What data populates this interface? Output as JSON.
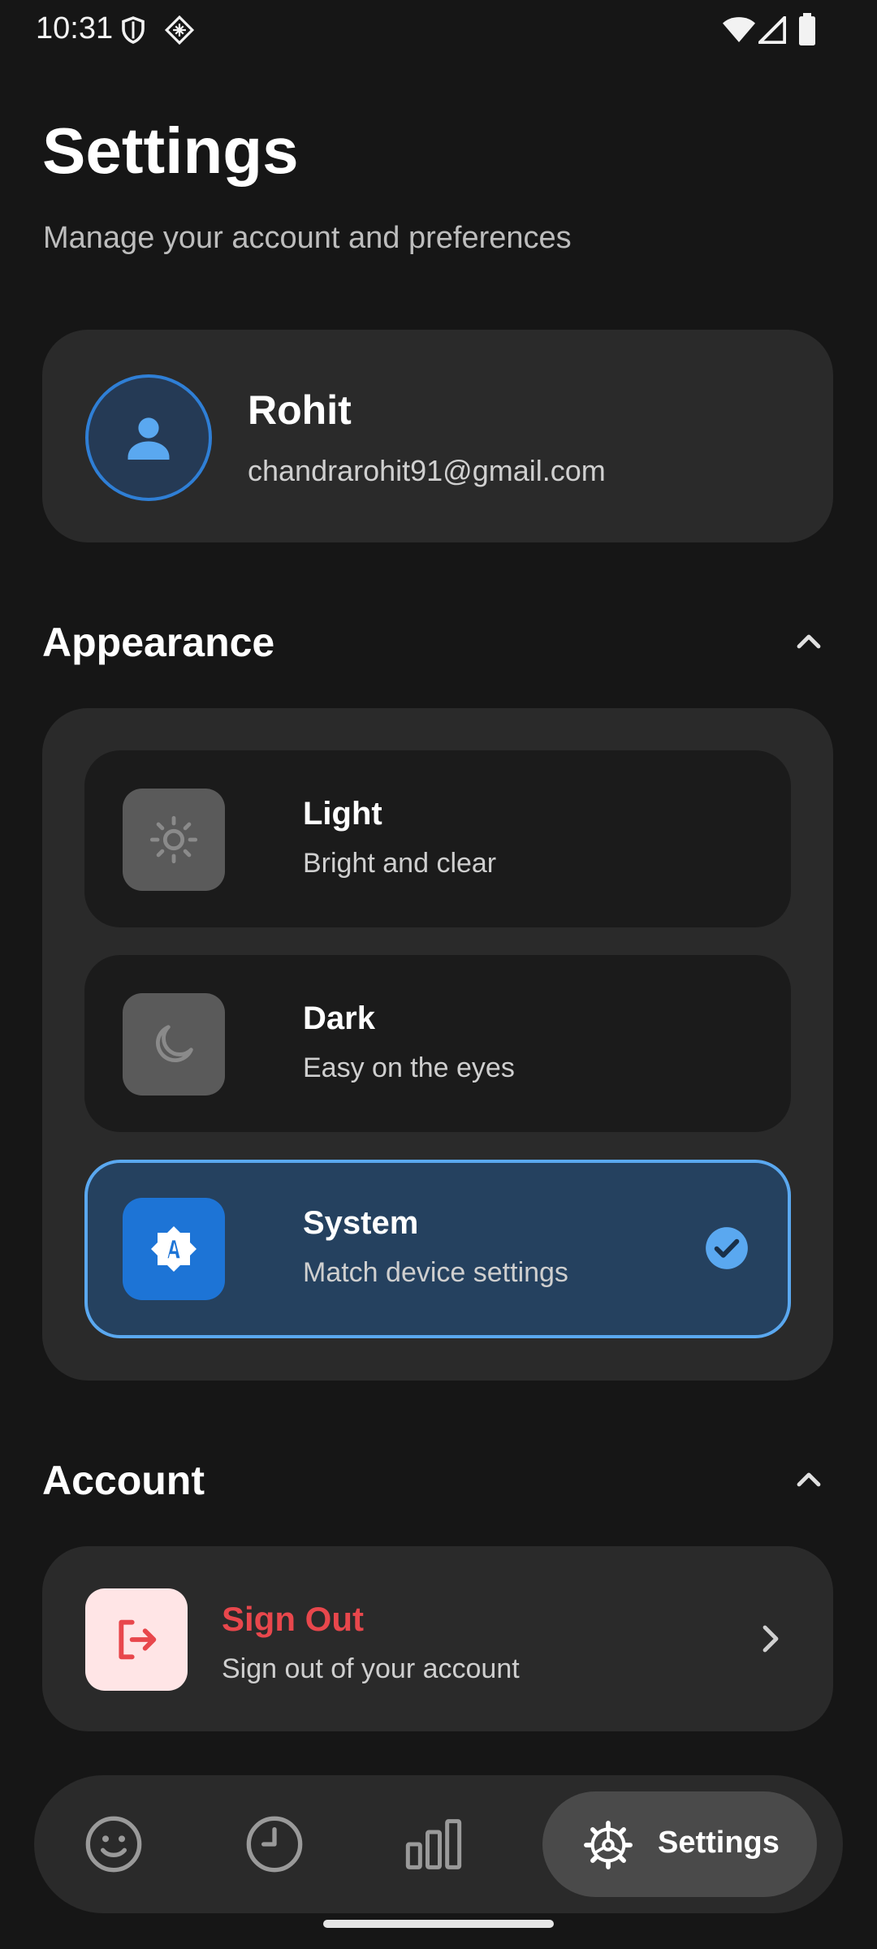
{
  "status_bar": {
    "time": "10:31",
    "left_icons": [
      "shield-icon",
      "diamond-grid-icon"
    ],
    "right_icons": [
      "wifi-icon",
      "cellular-icon",
      "battery-icon"
    ]
  },
  "header": {
    "title": "Settings",
    "subtitle": "Manage your account and preferences"
  },
  "profile": {
    "name": "Rohit",
    "email": "chandrarohit91@gmail.com",
    "avatar_icon": "person-icon"
  },
  "appearance": {
    "section_title": "Appearance",
    "collapse_icon": "chevron-up-icon",
    "options": [
      {
        "title": "Light",
        "description": "Bright and clear",
        "icon": "sun-icon",
        "selected": false
      },
      {
        "title": "Dark",
        "description": "Easy on the eyes",
        "icon": "moon-icon",
        "selected": false
      },
      {
        "title": "System",
        "description": "Match device settings",
        "icon": "auto-brightness-icon",
        "selected": true
      }
    ]
  },
  "account": {
    "section_title": "Account",
    "collapse_icon": "chevron-up-icon",
    "sign_out": {
      "title": "Sign Out",
      "description": "Sign out of your account",
      "icon": "logout-icon"
    }
  },
  "bottom_nav": {
    "items": [
      {
        "icon": "smiley-icon",
        "active": false
      },
      {
        "icon": "clock-icon",
        "active": false
      },
      {
        "icon": "bar-chart-icon",
        "active": false
      },
      {
        "icon": "settings-gear-icon",
        "label": "Settings",
        "active": true
      }
    ]
  },
  "colors": {
    "background": "#161616",
    "card": "#2a2a2a",
    "accent_blue": "#1d74d6",
    "selected_border": "#5aa8f0",
    "danger": "#e8474c"
  }
}
